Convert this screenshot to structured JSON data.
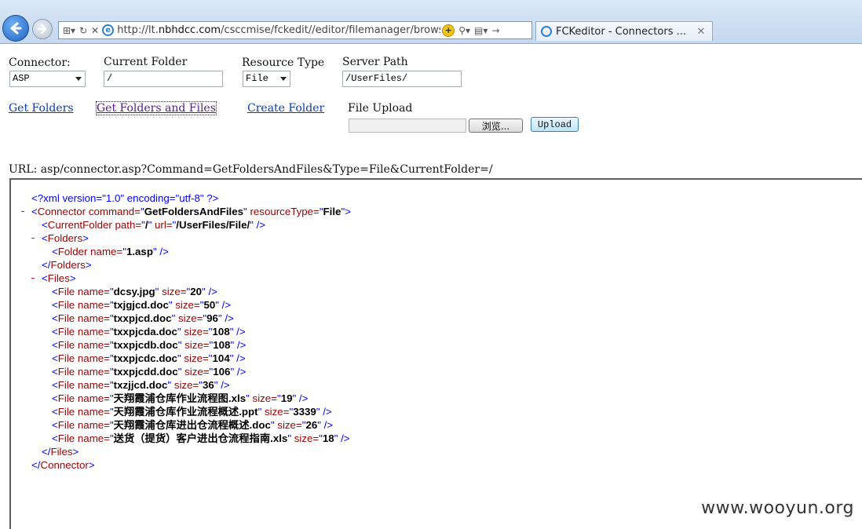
{
  "browser": {
    "url_prefix": "http://lt.",
    "url_domain": "nbhdcc.com",
    "url_rest": "/csccmise/fckedit//editor/filemanager/browser/defa",
    "tab_title": "FCKeditor - Connectors ...",
    "tab_close": "✕",
    "compat_icon": "+"
  },
  "form": {
    "connector_label": "Connector:",
    "connector_value": "ASP",
    "current_folder_label": "Current Folder",
    "current_folder_value": "/",
    "resource_type_label": "Resource Type",
    "resource_type_value": "File",
    "server_path_label": "Server Path",
    "server_path_value": "/UserFiles/",
    "get_folders": "Get Folders",
    "get_folders_files": "Get Folders and Files",
    "create_folder": "Create Folder",
    "file_upload_label": "File Upload",
    "browse_button": "浏览...",
    "upload_button": "Upload"
  },
  "url_line": "URL: asp/connector.asp?Command=GetFoldersAndFiles&Type=File&CurrentFolder=/",
  "xml": {
    "decl": "<?xml version=\"1.0\" encoding=\"utf-8\" ?>",
    "connector_command": "GetFoldersAndFiles",
    "connector_resource_type": "File",
    "current_folder_path": "/",
    "current_folder_url": "/UserFiles/File/",
    "folders": [
      "1.asp"
    ],
    "files": [
      {
        "name": "dcsy.jpg",
        "size": "20"
      },
      {
        "name": "txjgjcd.doc",
        "size": "50"
      },
      {
        "name": "txxpjcd.doc",
        "size": "96"
      },
      {
        "name": "txxpjcda.doc",
        "size": "108"
      },
      {
        "name": "txxpjcdb.doc",
        "size": "108"
      },
      {
        "name": "txxpjcdc.doc",
        "size": "104"
      },
      {
        "name": "txxpjcdd.doc",
        "size": "106"
      },
      {
        "name": "txzjjcd.doc",
        "size": "36"
      },
      {
        "name": "天翔霞浦仓库作业流程图.xls",
        "size": "19"
      },
      {
        "name": "天翔霞浦仓库作业流程概述.ppt",
        "size": "3339"
      },
      {
        "name": "天翔霞浦仓库进出仓流程概述.doc",
        "size": "26"
      },
      {
        "name": "送货（提货）客户进出仓流程指南.xls",
        "size": "18"
      }
    ],
    "collapse_marker": "-"
  },
  "watermark": "www.wooyun.org"
}
